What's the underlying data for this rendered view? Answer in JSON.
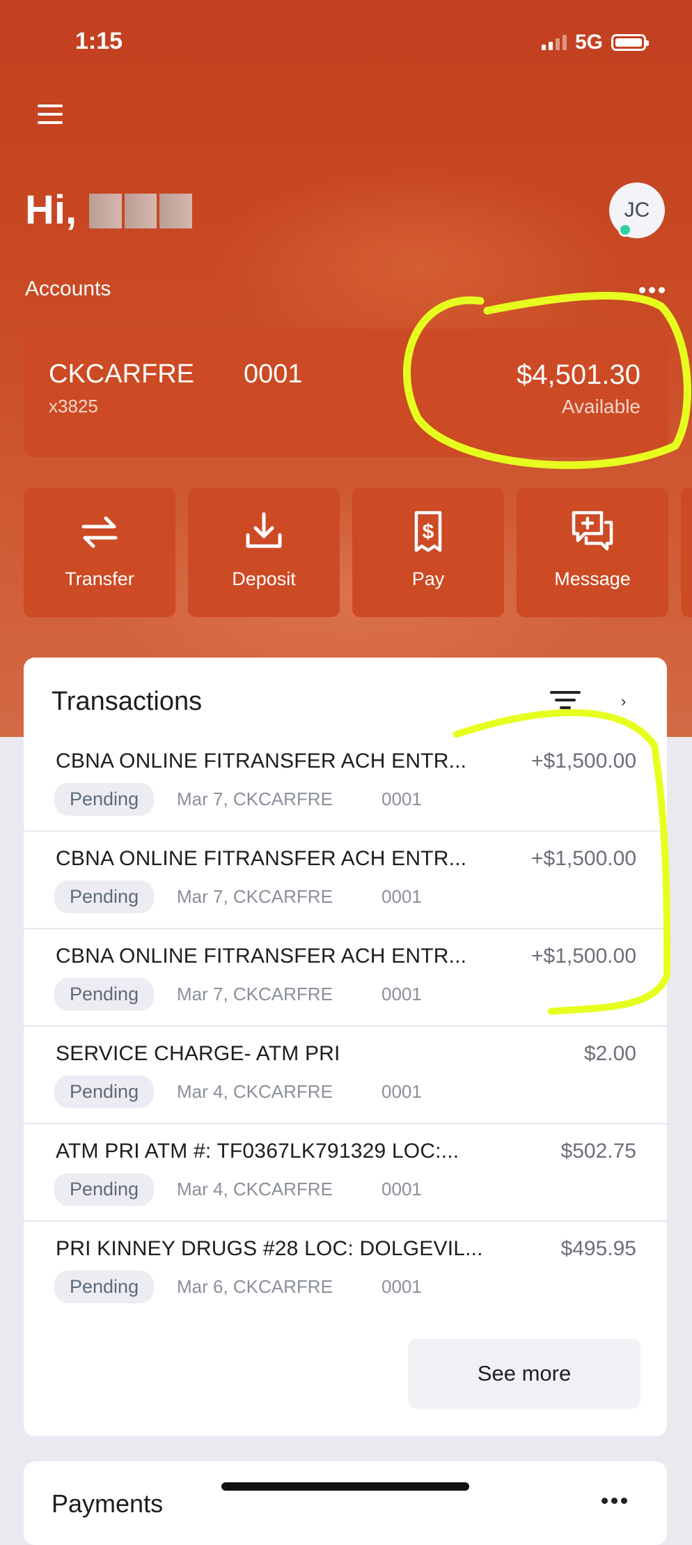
{
  "status_bar": {
    "time": "1:15",
    "network": "5G"
  },
  "header": {
    "greeting": "Hi,",
    "avatar_initials": "JC",
    "accounts_label": "Accounts"
  },
  "account": {
    "name": "CKCARFRE",
    "number": "0001",
    "mask": "x3825",
    "balance": "$4,501.30",
    "balance_label": "Available"
  },
  "actions": [
    {
      "label": "Transfer",
      "icon": "transfer-icon"
    },
    {
      "label": "Deposit",
      "icon": "deposit-icon"
    },
    {
      "label": "Pay",
      "icon": "bill-pay-icon"
    },
    {
      "label": "Message",
      "icon": "message-icon"
    }
  ],
  "transactions": {
    "title": "Transactions",
    "rows": [
      {
        "desc": "CBNA ONLINE FITRANSFER ACH ENTR...",
        "amount": "+$1,500.00",
        "status": "Pending",
        "meta": "Mar 7, CKCARFRE",
        "acct": "0001"
      },
      {
        "desc": "CBNA ONLINE FITRANSFER ACH ENTR...",
        "amount": "+$1,500.00",
        "status": "Pending",
        "meta": "Mar 7, CKCARFRE",
        "acct": "0001"
      },
      {
        "desc": "CBNA ONLINE FITRANSFER ACH ENTR...",
        "amount": "+$1,500.00",
        "status": "Pending",
        "meta": "Mar 7, CKCARFRE",
        "acct": "0001"
      },
      {
        "desc": "SERVICE CHARGE- ATM PRI",
        "amount": "$2.00",
        "status": "Pending",
        "meta": "Mar 4, CKCARFRE",
        "acct": "0001"
      },
      {
        "desc": "ATM PRI ATM #: TF0367LK791329 LOC:...",
        "amount": "$502.75",
        "status": "Pending",
        "meta": "Mar 4, CKCARFRE",
        "acct": "0001"
      },
      {
        "desc": "PRI KINNEY DRUGS #28 LOC: DOLGEVIL...",
        "amount": "$495.95",
        "status": "Pending",
        "meta": "Mar 6, CKCARFRE",
        "acct": "0001"
      }
    ],
    "see_more": "See more"
  },
  "payments": {
    "title": "Payments"
  },
  "colors": {
    "brand": "#c94a24",
    "card": "#cc4a24",
    "annotation": "#e6ff1f",
    "online_dot": "#2fd1a1"
  }
}
